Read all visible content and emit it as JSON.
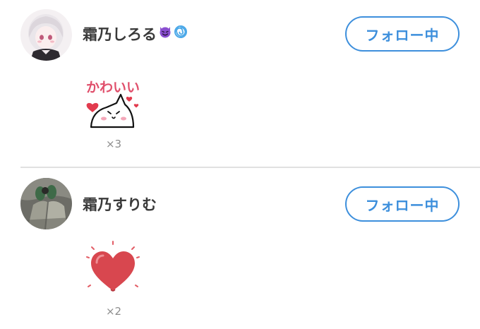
{
  "entries": [
    {
      "username": "霜乃しろる",
      "name_emojis": [
        "smiling-devil-emoji",
        "cyclone-emoji"
      ],
      "follow_label": "フォロー中",
      "reaction": {
        "sticker": "kawaii-cat-sticker",
        "sticker_text": "かわいい",
        "count": "×3"
      }
    },
    {
      "username": "霜乃すりむ",
      "follow_label": "フォロー中",
      "reaction": {
        "sticker": "red-heart-sticker",
        "count": "×2"
      }
    }
  ],
  "colors": {
    "accent": "#3d8fdc",
    "text": "#3a3a3a",
    "count": "#8c8c8c",
    "divider": "#e1e1e1",
    "heart": "#d8474f",
    "devil": "#8a4fd0",
    "cyclone": "#4aa8e8"
  }
}
